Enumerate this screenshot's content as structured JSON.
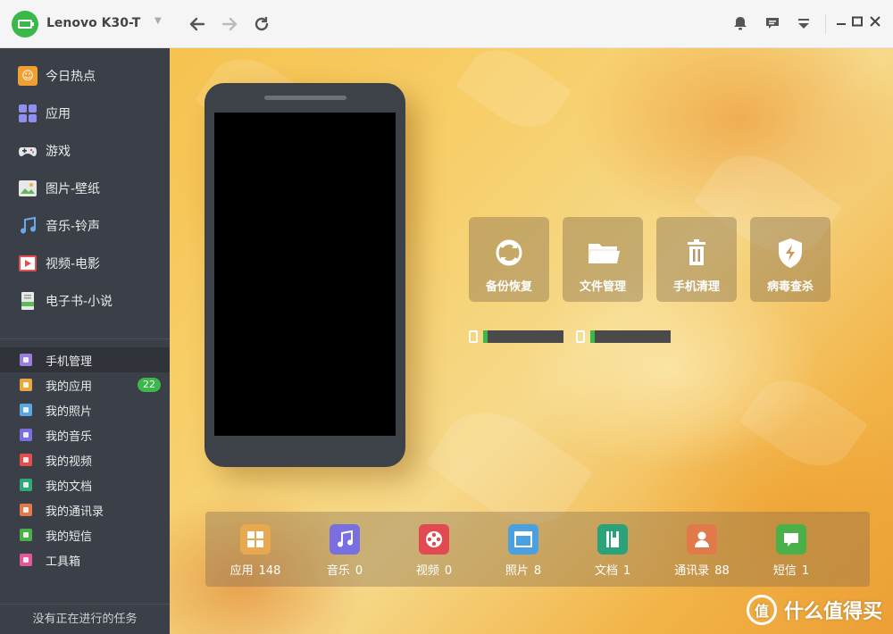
{
  "titlebar": {
    "device_name": "Lenovo K30-T",
    "icons": [
      "battery-icon",
      "chevron-down-icon",
      "back-arrow-icon",
      "forward-arrow-icon",
      "refresh-icon",
      "bell-icon",
      "message-icon",
      "menu-icon",
      "minimize-icon",
      "maximize-icon",
      "close-icon"
    ]
  },
  "sidebar": {
    "top_items": [
      {
        "label": "今日热点",
        "icon": "hot-news-icon",
        "color": "#f0a030"
      },
      {
        "label": "应用",
        "icon": "apps-icon",
        "color": "#8e8ff0"
      },
      {
        "label": "游戏",
        "icon": "gamepad-icon",
        "color": "#e0e0e0"
      },
      {
        "label": "图片-壁纸",
        "icon": "picture-icon",
        "color": "#5fb85a"
      },
      {
        "label": "音乐-铃声",
        "icon": "music-note-icon",
        "color": "#6aa8e8"
      },
      {
        "label": "视频-电影",
        "icon": "video-icon",
        "color": "#e05050"
      },
      {
        "label": "电子书-小说",
        "icon": "ebook-icon",
        "color": "#e0e0e0"
      }
    ],
    "manage_items": [
      {
        "label": "手机管理",
        "icon": "phone-manage-icon",
        "color": "#9b7fd8",
        "active": true
      },
      {
        "label": "我的应用",
        "icon": "my-apps-icon",
        "color": "#e8a840",
        "badge": "22"
      },
      {
        "label": "我的照片",
        "icon": "my-photos-icon",
        "color": "#5aa8e0"
      },
      {
        "label": "我的音乐",
        "icon": "my-music-icon",
        "color": "#7a6fe0"
      },
      {
        "label": "我的视频",
        "icon": "my-video-icon",
        "color": "#e05050"
      },
      {
        "label": "我的文档",
        "icon": "my-docs-icon",
        "color": "#2eaa7a"
      },
      {
        "label": "我的通讯录",
        "icon": "my-contacts-icon",
        "color": "#e07a4a"
      },
      {
        "label": "我的短信",
        "icon": "my-sms-icon",
        "color": "#4ab04a"
      },
      {
        "label": "工具箱",
        "icon": "toolbox-icon",
        "color": "#e05a9a"
      }
    ],
    "status": "没有正在进行的任务"
  },
  "tools": [
    {
      "label": "备份恢复",
      "icon": "backup-restore-icon"
    },
    {
      "label": "文件管理",
      "icon": "folder-icon"
    },
    {
      "label": "手机清理",
      "icon": "trash-icon"
    },
    {
      "label": "病毒查杀",
      "icon": "shield-icon"
    }
  ],
  "storage": [
    {
      "icon": "phone-storage-icon",
      "used_fraction": 0.06
    },
    {
      "icon": "sd-card-icon",
      "used_fraction": 0.06
    }
  ],
  "categories": [
    {
      "label": "应用",
      "count": "148",
      "icon": "apps-grid-icon",
      "color": "#e8a850"
    },
    {
      "label": "音乐",
      "count": "0",
      "icon": "music-note-icon",
      "color": "#7a6fe0"
    },
    {
      "label": "视频",
      "count": "0",
      "icon": "film-reel-icon",
      "color": "#e04a50"
    },
    {
      "label": "照片",
      "count": "8",
      "icon": "photo-frame-icon",
      "color": "#4aa0e0"
    },
    {
      "label": "文档",
      "count": "1",
      "icon": "book-icon",
      "color": "#2aa37a"
    },
    {
      "label": "通讯录",
      "count": "88",
      "icon": "contact-icon",
      "color": "#e07a4a"
    },
    {
      "label": "短信",
      "count": "1",
      "icon": "chat-bubble-icon",
      "color": "#4ab04a"
    }
  ],
  "watermark": {
    "text": "什么值得买",
    "logo_text": "值"
  }
}
